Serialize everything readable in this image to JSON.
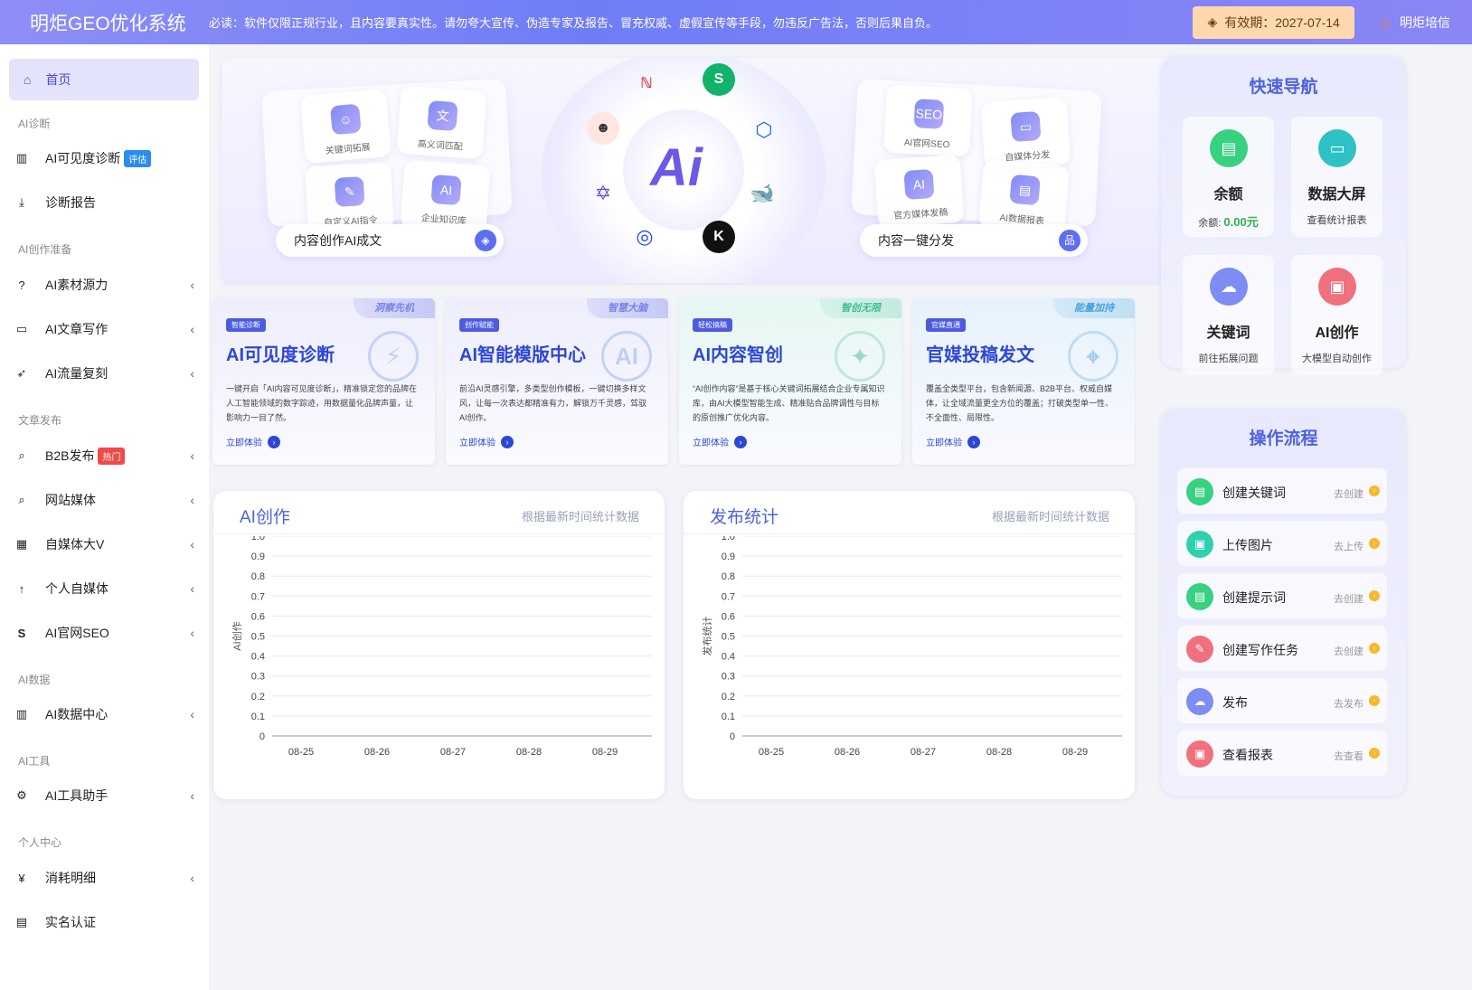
{
  "topbar": {
    "brand": "明炬GEO优化系统",
    "notice": "必读：软件仅限正规行业，且内容要真实性。请勿夸大宣传、伪造专家及报告、冒充权威、虚假宣传等手段，勿违反广告法，否则后果自负。",
    "expire": "有效期：2027-07-14",
    "user": "明炬培信"
  },
  "sidebar": {
    "home": "首页",
    "sections": [
      "AI诊断",
      "AI创作准备",
      "文章发布",
      "AI数据",
      "AI工具",
      "个人中心"
    ],
    "items": [
      {
        "label": "AI可见度诊断",
        "badge": "评估",
        "icon": "chart-icon"
      },
      {
        "label": "诊断报告",
        "icon": "download-icon"
      },
      {
        "label": "AI素材源力",
        "icon": "question-icon"
      },
      {
        "label": "AI文章写作",
        "icon": "folder-icon"
      },
      {
        "label": "AI流量复刻",
        "icon": "rocket-icon"
      },
      {
        "label": "B2B发布",
        "badge": "热门",
        "icon": "search-icon"
      },
      {
        "label": "网站媒体",
        "icon": "search-icon"
      },
      {
        "label": "自媒体大V",
        "icon": "grid-icon"
      },
      {
        "label": "个人自媒体",
        "icon": "arrow-up-icon"
      },
      {
        "label": "AI官网SEO",
        "icon": "seo-icon"
      },
      {
        "label": "AI数据中心",
        "icon": "chart-icon"
      },
      {
        "label": "AI工具助手",
        "icon": "gear-icon"
      },
      {
        "label": "消耗明细",
        "icon": "yen-icon"
      },
      {
        "label": "实名认证",
        "icon": "id-card-icon"
      }
    ]
  },
  "hero": {
    "left_tiles": [
      "关键词拓展",
      "高义词匹配",
      "自定义AI指令",
      "企业知识库"
    ],
    "left_pill": "内容创作AI成文",
    "right_tiles": [
      "AI官网SEO",
      "自媒体分发",
      "官方媒体发稿",
      "AI数据报表"
    ],
    "right_pill": "内容一键分发",
    "center": "Ai"
  },
  "features": [
    {
      "corner": "洞察先机",
      "tag": "智能诊断",
      "title": "AI可见度诊断",
      "desc": "一键开启「AI内容可见度诊断」，精准锁定您的品牌在人工智能领域的数字踪迹，用数据量化品牌声量，让影响力一目了然。",
      "link": "立即体验"
    },
    {
      "corner": "智慧大脑",
      "tag": "创作赋能",
      "title": "AI智能模版中心",
      "desc": "前沿AI灵感引擎，多类型创作模板，一键切换多样文风，让每一次表达都精准有力，解锁万千灵感，驾驭AI创作。",
      "link": "立即体验"
    },
    {
      "corner": "智创无限",
      "tag": "轻松搞稿",
      "title": "AI内容智创",
      "desc": "“AI创作内容”是基于核心关键词拓展结合企业专属知识库，由AI大模型智能生成、精准贴合品牌调性与目标的原创推广优化内容。",
      "link": "立即体验"
    },
    {
      "corner": "能量加持",
      "tag": "官媒直通",
      "title": "官媒投稿发文",
      "desc": "覆盖全类型平台，包含新闻源、B2B平台、权威自媒体，让全域流量更全方位的覆盖；打破类型单一性、不全面性、局限性。",
      "link": "立即体验"
    }
  ],
  "charts": [
    {
      "title": "AI创作",
      "subtitle": "根据最新时间统计数据"
    },
    {
      "title": "发布统计",
      "subtitle": "根据最新时间统计数据"
    }
  ],
  "chart_data": [
    {
      "type": "bar",
      "ylabel": "AI创作",
      "categories": [
        "08-25",
        "08-26",
        "08-27",
        "08-28",
        "08-29"
      ],
      "values": [],
      "ylim": [
        0,
        1
      ],
      "yticks": [
        "0",
        "0.1",
        "0.2",
        "0.3",
        "0.4",
        "0.5",
        "0.6",
        "0.7",
        "0.8",
        "0.9",
        "1.0"
      ]
    },
    {
      "type": "bar",
      "ylabel": "发布统计",
      "categories": [
        "08-25",
        "08-26",
        "08-27",
        "08-28",
        "08-29"
      ],
      "values": [],
      "ylim": [
        0,
        1
      ],
      "yticks": [
        "0",
        "0.1",
        "0.2",
        "0.3",
        "0.4",
        "0.5",
        "0.6",
        "0.7",
        "0.8",
        "0.9",
        "1.0"
      ]
    }
  ],
  "quicknav": {
    "title": "快速导航",
    "items": [
      {
        "title": "余额",
        "sub_label": "余额:",
        "sub_value": "0.00元",
        "color": "#37d17f"
      },
      {
        "title": "数据大屏",
        "sub_label": "查看统计报表",
        "sub_value": "",
        "color": "#2fc2c4"
      },
      {
        "title": "关键词",
        "sub_label": "前往拓展问题",
        "sub_value": "",
        "color": "#7e8cf3"
      },
      {
        "title": "AI创作",
        "sub_label": "大模型自动创作",
        "sub_value": "",
        "color": "#f0707e"
      }
    ]
  },
  "workflow": {
    "title": "操作流程",
    "steps": [
      {
        "label": "创建关键词",
        "go": "去创建",
        "color": "#37d17f"
      },
      {
        "label": "上传图片",
        "go": "去上传",
        "color": "#2fd0b0"
      },
      {
        "label": "创建提示词",
        "go": "去创建",
        "color": "#37d17f"
      },
      {
        "label": "创建写作任务",
        "go": "去创建",
        "color": "#f0707e"
      },
      {
        "label": "发布",
        "go": "去发布",
        "color": "#7e8cf3"
      },
      {
        "label": "查看报表",
        "go": "去查看",
        "color": "#f0707e"
      }
    ]
  }
}
